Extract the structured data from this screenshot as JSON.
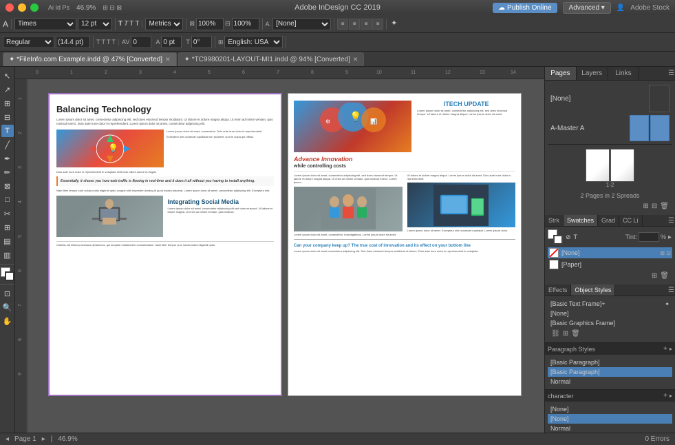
{
  "titlebar": {
    "app_name": "Adobe InDesign CC 2019",
    "zoom": "46.9%",
    "publish_label": "Publish Online",
    "advanced_label": "Advanced",
    "stock_label": "Adobe Stock"
  },
  "toolbar": {
    "font_family": "Times",
    "font_size": "12 pt",
    "size_label": "14.4 pt",
    "style": "Regular",
    "scale_x": "100%",
    "scale_y": "100%",
    "offset": "0",
    "tracking": "0 pt",
    "angle": "0°",
    "metrics": "Metrics",
    "lang": "English: USA",
    "none_label": "[None]"
  },
  "tabs": {
    "tab1_label": "✦ *FileInfo.com Example.indd @ 47% [Converted]",
    "tab2_label": "✦ *TC9980201-LAYOUT-MI1.indd @ 94% [Converted]"
  },
  "pages_panel": {
    "title": "Pages",
    "layers_tab": "Layers",
    "links_tab": "Links",
    "none_label": "[None]",
    "master_label": "A-Master A",
    "spread_info": "2 Pages in 2 Spreads"
  },
  "swatches_panel": {
    "stroke_tab": "Strk",
    "swatches_tab": "Swatches",
    "grad_tab": "Grad",
    "cc_tab": "CC Li",
    "tint_label": "Tint:",
    "tint_value": "%",
    "items": [
      {
        "name": "[None]",
        "color": "transparent",
        "selected": true
      },
      {
        "name": "[Paper]",
        "color": "#ffffff"
      }
    ]
  },
  "effects_panel": {
    "effects_tab": "Effects",
    "object_styles_tab": "Object Styles",
    "basic_text_frame": "[Basic Text Frame]+",
    "none_item": "[None]",
    "basic_graphics": "[Basic Graphics Frame]"
  },
  "paragraph_styles": {
    "title": "Paragraph Styles",
    "add_icon": "+",
    "items": [
      {
        "name": "[Basic Paragraph]",
        "selected": false
      },
      {
        "name": "[Basic Paragraph]",
        "selected": true
      },
      {
        "name": "Normal",
        "selected": false
      }
    ]
  },
  "character_styles": {
    "title": "character",
    "items": [
      {
        "name": "[None]",
        "selected": false
      },
      {
        "name": "[None]",
        "selected": true
      },
      {
        "name": "Normal",
        "selected": false
      }
    ]
  },
  "document": {
    "left_page": {
      "title": "Balancing Technology",
      "body_text": "Lorem ipsum dolor sit amet, consectetur adipiscing elit, sed does eiusmod tempor incididunt ut labore et dolore magna aliqua. Ut enim ad minim veniam, quis nostrud exerci tation ullamcorper. Lorem ipsum dolor sit amet.",
      "quote": "Essentially, it shows you how web traffic is flowing in real-time and it does it all without you having to install anything.",
      "social_header": "Integrating Social Media",
      "social_body": "Lorem ipsum dolor sit amet, consectetur adipiscing elit, sed does eiusmod tempor incididunt ut labore."
    },
    "right_page": {
      "itech_title": "ITECH UPDATE",
      "advance_title": "Advance Innovation",
      "advance_sub": "while controlling costs",
      "can_company": "Can your company keep up? The true cost of innovation and its effect on your bottom line",
      "body_text": "Lorem ipsum dolor sit amet consectetur adipiscing elit sed does eiusmod tempor."
    }
  },
  "status_bar": {
    "page_info": "Page 1",
    "zoom_label": "46.9%",
    "errors": "0 Errors"
  },
  "colors": {
    "accent_blue": "#4a7fb5",
    "toolbar_bg": "#3c3c3c",
    "panel_bg": "#3c3c3c",
    "canvas_bg": "#535353",
    "active_tab": "#636363",
    "red": "#e74c3c",
    "blue": "#2980b9"
  }
}
